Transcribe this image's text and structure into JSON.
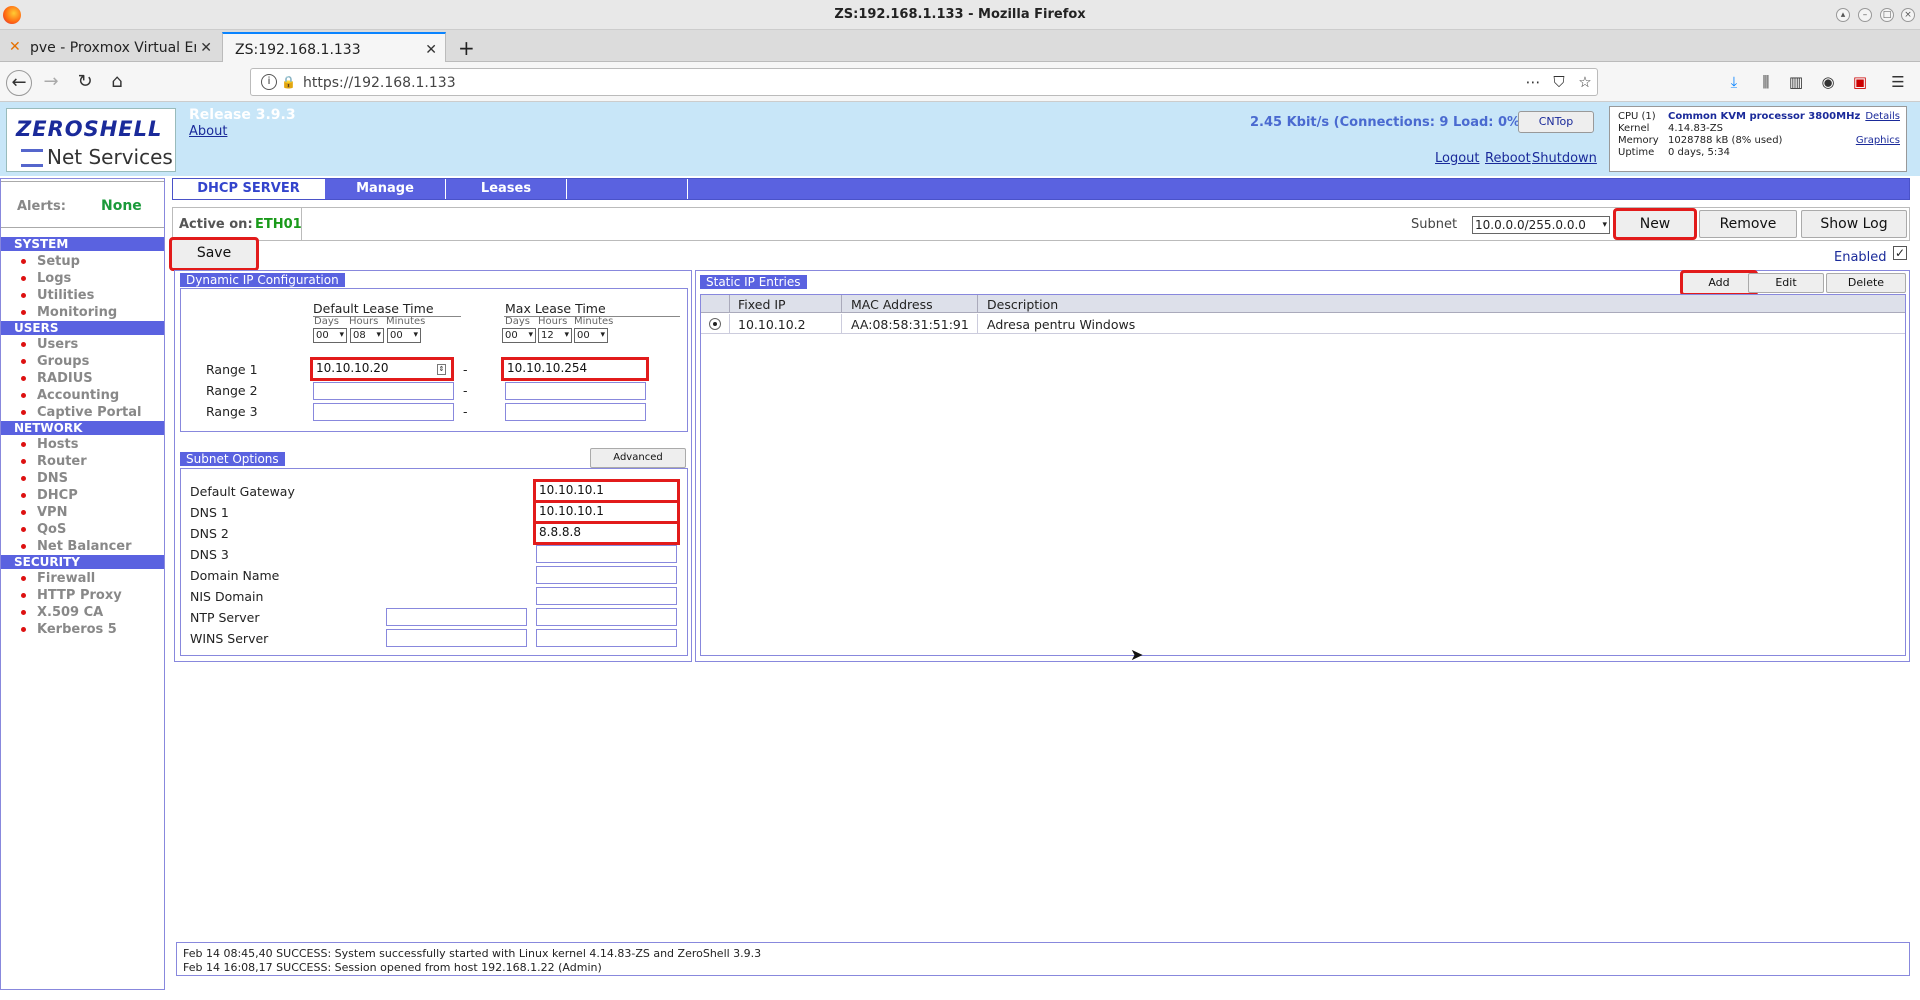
{
  "browser": {
    "window_title": "ZS:192.168.1.133 - Mozilla Firefox",
    "tabs": [
      {
        "label": "pve - Proxmox Virtual En",
        "active": false
      },
      {
        "label": "ZS:192.168.1.133",
        "active": true
      }
    ],
    "url": "https://192.168.1.133"
  },
  "header": {
    "logo_top": "ZEROSHELL",
    "logo_bottom": "Net Services",
    "release": "Release 3.9.3",
    "about": "About",
    "rate": "2.45 Kbit/s (Connections: 9 Load: 0%)",
    "cntop": "CNTop",
    "logout": "Logout",
    "reboot": "Reboot",
    "shutdown": "Shutdown",
    "sysinfo": {
      "cpu_label": "CPU (1)",
      "cpu_value": "Common KVM processor 3800MHz",
      "kernel_label": "Kernel",
      "kernel_value": "4.14.83-ZS",
      "memory_label": "Memory",
      "memory_value": "1028788 kB  (8% used)",
      "uptime_label": "Uptime",
      "uptime_value": "0 days, 5:34",
      "details": "Details",
      "graphics": "Graphics"
    }
  },
  "sidebar": {
    "alerts_label": "Alerts:",
    "alerts_value": "None",
    "sections": [
      {
        "title": "SYSTEM",
        "items": [
          "Setup",
          "Logs",
          "Utilities",
          "Monitoring"
        ]
      },
      {
        "title": "USERS",
        "items": [
          "Users",
          "Groups",
          "RADIUS",
          "Accounting",
          "Captive Portal"
        ]
      },
      {
        "title": "NETWORK",
        "items": [
          "Hosts",
          "Router",
          "DNS",
          "DHCP",
          "VPN",
          "QoS",
          "Net Balancer"
        ]
      },
      {
        "title": "SECURITY",
        "items": [
          "Firewall",
          "HTTP Proxy",
          "X.509 CA",
          "Kerberos 5"
        ]
      }
    ]
  },
  "main": {
    "tabs": [
      "DHCP SERVER",
      "Manage",
      "Leases"
    ],
    "active_on_label": "Active on:",
    "active_on_value": "ETH01",
    "subnet_label": "Subnet",
    "subnet_value": "10.0.0.0/255.0.0.0",
    "new": "New",
    "remove": "Remove",
    "show_log": "Show Log",
    "save": "Save",
    "enabled": "Enabled",
    "dynamic": {
      "title": "Dynamic IP Configuration",
      "default_lease": "Default Lease Time",
      "max_lease": "Max Lease Time",
      "days": "Days",
      "hours": "Hours",
      "minutes": "Minutes",
      "default_days": "00",
      "default_hours": "08",
      "default_minutes": "00",
      "max_days": "00",
      "max_hours": "12",
      "max_minutes": "00",
      "range1_label": "Range 1",
      "range2_label": "Range 2",
      "range3_label": "Range 3",
      "range1_start": "10.10.10.20",
      "range1_end": "10.10.10.254",
      "dash": "-"
    },
    "subnet_options": {
      "title": "Subnet Options",
      "advanced": "Advanced",
      "gateway_label": "Default Gateway",
      "gateway": "10.10.10.1",
      "dns1_label": "DNS 1",
      "dns1": "10.10.10.1",
      "dns2_label": "DNS 2",
      "dns2": "8.8.8.8",
      "dns3_label": "DNS 3",
      "domain_label": "Domain Name",
      "nis_label": "NIS Domain",
      "ntp_label": "NTP Server",
      "wins_label": "WINS Server"
    },
    "static": {
      "title": "Static IP Entries",
      "add": "Add",
      "edit": "Edit",
      "delete": "Delete",
      "columns": [
        "Fixed IP",
        "MAC Address",
        "Description"
      ],
      "rows": [
        {
          "ip": "10.10.10.2",
          "mac": "AA:08:58:31:51:91",
          "desc": "Adresa pentru Windows"
        }
      ]
    }
  },
  "log": [
    "Feb 14 08:45,40 SUCCESS: System successfully started with Linux kernel 4.14.83-ZS and ZeroShell 3.9.3",
    "Feb 14 16:08,17 SUCCESS: Session opened from host 192.168.1.22 (Admin)"
  ]
}
